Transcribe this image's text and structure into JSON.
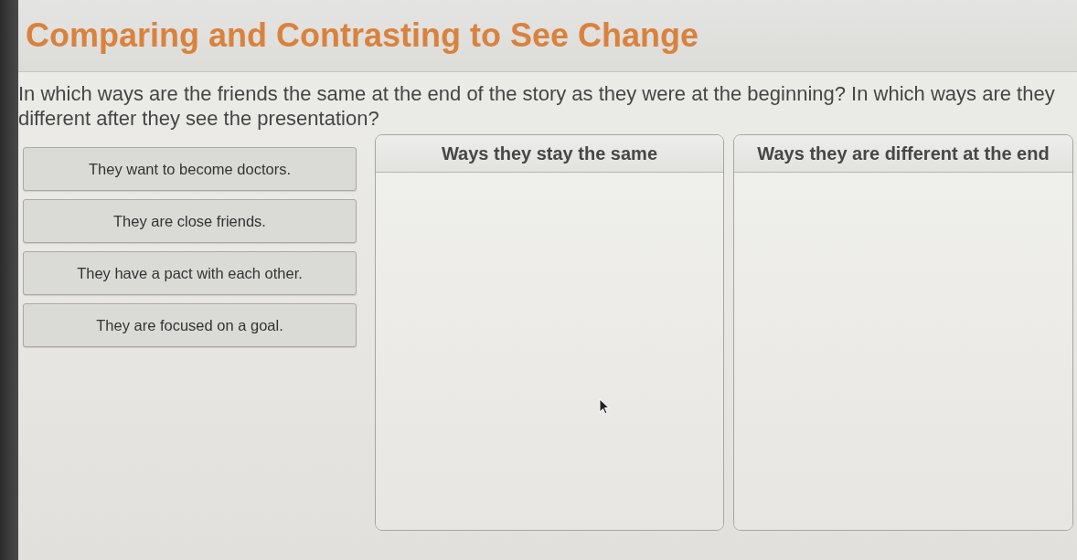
{
  "title": "Comparing and Contrasting to See Change",
  "question": "In which ways are the friends the same at the end of the story as they were at the beginning? In which ways are they different after they see the presentation?",
  "answer_choices": [
    {
      "text": "They want to become doctors."
    },
    {
      "text": "They are close friends."
    },
    {
      "text": "They have a pact with each other."
    },
    {
      "text": "They are focused on a goal."
    }
  ],
  "categories": [
    {
      "heading": "Ways they stay the same"
    },
    {
      "heading": "Ways they are different at the end"
    }
  ]
}
